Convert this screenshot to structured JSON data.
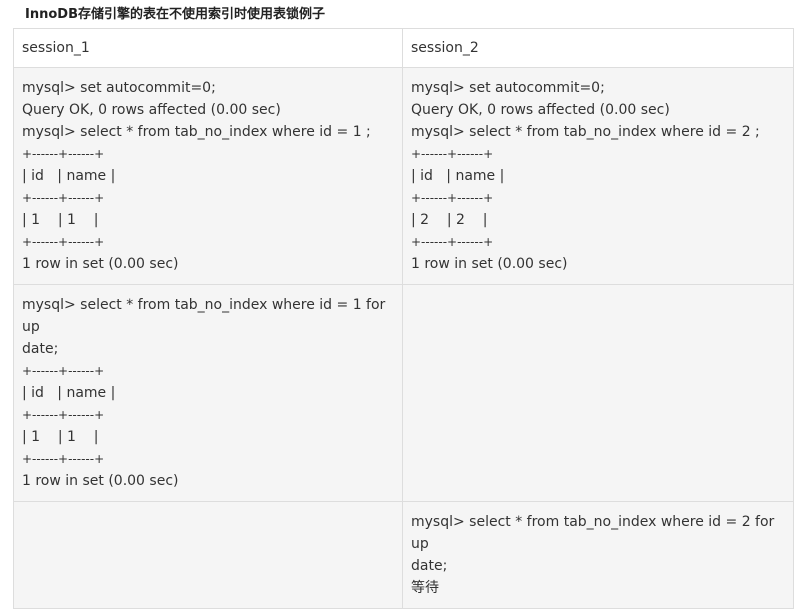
{
  "title": "InnoDB存储引擎的表在不使用索引时使用表锁例子",
  "table": {
    "headers": [
      "session_1",
      "session_2"
    ],
    "rows": [
      {
        "session_1": [
          "mysql> set autocommit=0;",
          "Query OK, 0 rows affected (0.00 sec)",
          "mysql> select * from tab_no_index where id = 1 ;",
          "+------+------+",
          "| id   | name |",
          "+------+------+",
          "| 1    | 1    |",
          "+------+------+",
          "1 row in set (0.00 sec)"
        ],
        "session_2": [
          "mysql> set autocommit=0;",
          "Query OK, 0 rows affected (0.00 sec)",
          "mysql> select * from tab_no_index where id = 2 ;",
          "+------+------+",
          "| id   | name |",
          "+------+------+",
          "| 2    | 2    |",
          "+------+------+",
          "1 row in set (0.00 sec)"
        ]
      },
      {
        "session_1": [
          "mysql> select * from tab_no_index where id = 1 for up",
          "date;",
          "+------+------+",
          "| id   | name |",
          "+------+------+",
          "| 1    | 1    |",
          "+------+------+",
          "1 row in set (0.00 sec)"
        ],
        "session_2": []
      },
      {
        "session_1": [],
        "session_2": [
          "mysql> select * from tab_no_index where id = 2 for up",
          "date;",
          "等待"
        ]
      }
    ]
  }
}
